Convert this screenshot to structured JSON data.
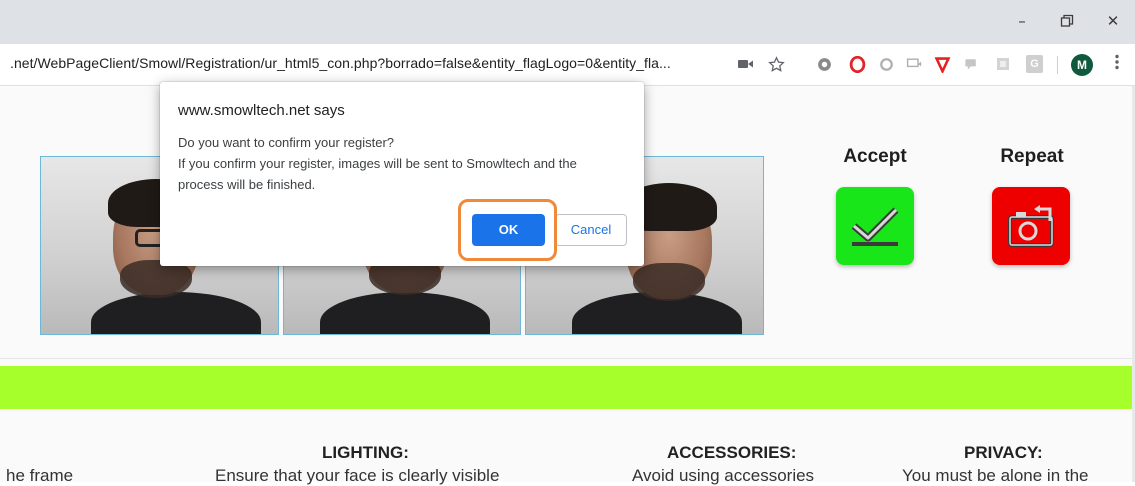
{
  "browser": {
    "url": ".net/WebPageClient/Smowl/Registration/ur_html5_con.php?borrado=false&entity_flagLogo=0&entity_fla...",
    "window_controls": {
      "minimize": "–",
      "restore": "❐",
      "close": "✕"
    },
    "profile_initial": "M",
    "extension_badge": "G"
  },
  "page": {
    "actions": {
      "accept_label": "Accept",
      "repeat_label": "Repeat",
      "accept_color": "#19e619",
      "repeat_color": "#ee0000"
    },
    "accent_bar_color": "#a6ff2b",
    "tips": [
      {
        "title": "",
        "text": "he frame"
      },
      {
        "title": "LIGHTING:",
        "text": "Ensure that your face is clearly visible"
      },
      {
        "title": "ACCESSORIES:",
        "text": "Avoid using accessories"
      },
      {
        "title": "PRIVACY:",
        "text": "You must be alone in the"
      }
    ]
  },
  "dialog": {
    "title": "www.smowltech.net says",
    "line1": "Do you want to confirm your register?",
    "line2": "If you confirm your register, images will be sent to Smowltech and the",
    "line3": "process will be finished.",
    "ok_label": "OK",
    "cancel_label": "Cancel",
    "ok_color": "#1a73e8",
    "highlight_color": "#f0893a"
  }
}
